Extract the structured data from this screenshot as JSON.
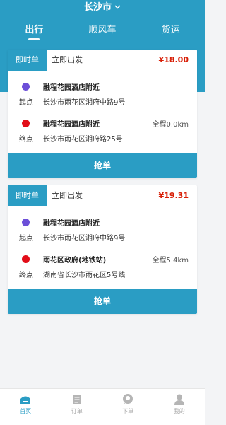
{
  "header": {
    "city": "长沙市",
    "tabs": [
      "出行",
      "顺风车",
      "货运"
    ],
    "active_tab": 0
  },
  "orders": [
    {
      "type": "即时单",
      "depart": "立即出发",
      "price": "¥18.00",
      "start": {
        "label": "起点",
        "name": "融程花园酒店附近",
        "address": "长沙市雨花区湘府中路9号"
      },
      "end": {
        "label": "终点",
        "name": "融程花园酒店附近",
        "address": "长沙市雨花区湘府路25号"
      },
      "distance": "全程0.0km",
      "action": "抢单"
    },
    {
      "type": "即时单",
      "depart": "立即出发",
      "price": "¥19.31",
      "start": {
        "label": "起点",
        "name": "融程花园酒店附近",
        "address": "长沙市雨花区湘府中路9号"
      },
      "end": {
        "label": "终点",
        "name": "雨花区政府(地铁站)",
        "address": "湖南省长沙市雨花区5号线"
      },
      "distance": "全程5.4km",
      "action": "抢单"
    }
  ],
  "bottom_nav": [
    {
      "label": "首页",
      "icon": "home-icon",
      "active": true
    },
    {
      "label": "订单",
      "icon": "order-icon",
      "active": false
    },
    {
      "label": "下单",
      "icon": "location-icon",
      "active": false
    },
    {
      "label": "我的",
      "icon": "user-icon",
      "active": false
    }
  ],
  "colors": {
    "primary": "#2a9dc4",
    "price": "#d81e06",
    "start_dot": "#6c4fd8",
    "end_dot": "#e20d18"
  }
}
